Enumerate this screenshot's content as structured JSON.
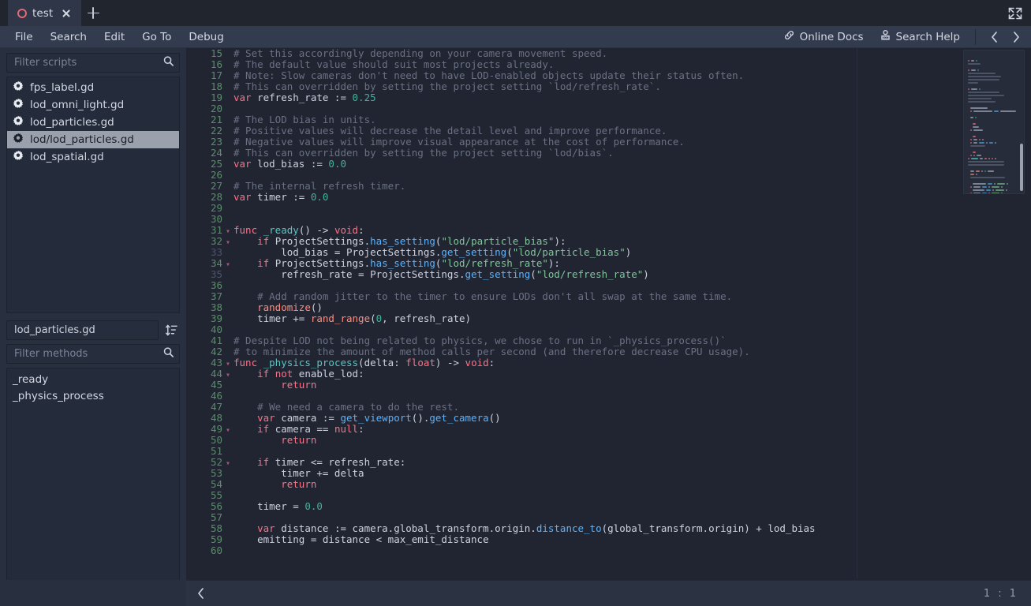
{
  "window": {
    "tab": {
      "name": "test",
      "close_label": "✕",
      "new_tab_label": "+"
    },
    "expand_icon": "fullscreen-icon"
  },
  "menu": {
    "items": [
      "File",
      "Search",
      "Edit",
      "Go To",
      "Debug"
    ],
    "online_docs": "Online Docs",
    "search_help": "Search Help",
    "prev_label": "‹",
    "next_label": "›"
  },
  "sidebar": {
    "filter_scripts_placeholder": "Filter scripts",
    "scripts": [
      {
        "label": "fps_label.gd",
        "selected": false
      },
      {
        "label": "lod_omni_light.gd",
        "selected": false
      },
      {
        "label": "lod_particles.gd",
        "selected": false
      },
      {
        "label": "lod/lod_particles.gd",
        "selected": true
      },
      {
        "label": "lod_spatial.gd",
        "selected": false
      }
    ],
    "current_script": "lod_particles.gd",
    "sort_icon": "sort-icon",
    "filter_methods_placeholder": "Filter methods",
    "methods": [
      "_ready",
      "_physics_process"
    ]
  },
  "status": {
    "back_label": "‹",
    "position": "1 : 1"
  },
  "editor": {
    "first_line": 15,
    "lines": [
      {
        "n": 15,
        "fold": "",
        "dim": false,
        "tokens": [
          {
            "t": "# Set this accordingly depending on your camera movement speed.",
            "c": "cm"
          }
        ]
      },
      {
        "n": 16,
        "fold": "",
        "dim": false,
        "tokens": [
          {
            "t": "# The default value should suit most projects already.",
            "c": "cm"
          }
        ]
      },
      {
        "n": 17,
        "fold": "",
        "dim": false,
        "tokens": [
          {
            "t": "# Note: Slow cameras don't need to have LOD-enabled objects update their status often.",
            "c": "cm"
          }
        ]
      },
      {
        "n": 18,
        "fold": "",
        "dim": false,
        "tokens": [
          {
            "t": "# This can overridden by setting the project setting `lod/refresh_rate`.",
            "c": "cm"
          }
        ]
      },
      {
        "n": 19,
        "fold": "",
        "dim": false,
        "tokens": [
          {
            "t": "var",
            "c": "kw"
          },
          {
            "t": " refresh_rate := ",
            "c": "pl"
          },
          {
            "t": "0.25",
            "c": "numlit"
          }
        ]
      },
      {
        "n": 20,
        "fold": "",
        "dim": false,
        "tokens": []
      },
      {
        "n": 21,
        "fold": "",
        "dim": false,
        "tokens": [
          {
            "t": "# The LOD bias in units.",
            "c": "cm"
          }
        ]
      },
      {
        "n": 22,
        "fold": "",
        "dim": false,
        "tokens": [
          {
            "t": "# Positive values will decrease the detail level and improve performance.",
            "c": "cm"
          }
        ]
      },
      {
        "n": 23,
        "fold": "",
        "dim": false,
        "tokens": [
          {
            "t": "# Negative values will improve visual appearance at the cost of performance.",
            "c": "cm"
          }
        ]
      },
      {
        "n": 24,
        "fold": "",
        "dim": false,
        "tokens": [
          {
            "t": "# This can overridden by setting the project setting `lod/bias`.",
            "c": "cm"
          }
        ]
      },
      {
        "n": 25,
        "fold": "",
        "dim": false,
        "tokens": [
          {
            "t": "var",
            "c": "kw"
          },
          {
            "t": " lod_bias := ",
            "c": "pl"
          },
          {
            "t": "0.0",
            "c": "numlit"
          }
        ]
      },
      {
        "n": 26,
        "fold": "",
        "dim": false,
        "tokens": []
      },
      {
        "n": 27,
        "fold": "",
        "dim": false,
        "tokens": [
          {
            "t": "# The internal refresh timer.",
            "c": "cm"
          }
        ]
      },
      {
        "n": 28,
        "fold": "",
        "dim": false,
        "tokens": [
          {
            "t": "var",
            "c": "kw"
          },
          {
            "t": " timer := ",
            "c": "pl"
          },
          {
            "t": "0.0",
            "c": "numlit"
          }
        ]
      },
      {
        "n": 29,
        "fold": "",
        "dim": false,
        "tokens": []
      },
      {
        "n": 30,
        "fold": "",
        "dim": false,
        "tokens": []
      },
      {
        "n": 31,
        "fold": "v",
        "dim": false,
        "tokens": [
          {
            "t": "func",
            "c": "kw"
          },
          {
            "t": " _ready",
            "c": "ty"
          },
          {
            "t": "() -> ",
            "c": "pl"
          },
          {
            "t": "void",
            "c": "kw"
          },
          {
            "t": ":",
            "c": "pl"
          }
        ]
      },
      {
        "n": 32,
        "fold": "v",
        "dim": false,
        "tokens": [
          {
            "t": "    ",
            "c": "pl"
          },
          {
            "t": "if",
            "c": "kw"
          },
          {
            "t": " ProjectSettings.",
            "c": "pl"
          },
          {
            "t": "has_setting",
            "c": "fn"
          },
          {
            "t": "(",
            "c": "pl"
          },
          {
            "t": "\"lod/particle_bias\"",
            "c": "str"
          },
          {
            "t": "):",
            "c": "pl"
          }
        ]
      },
      {
        "n": 33,
        "fold": "",
        "dim": true,
        "tokens": [
          {
            "t": "        lod_bias = ProjectSettings.",
            "c": "pl"
          },
          {
            "t": "get_setting",
            "c": "fn"
          },
          {
            "t": "(",
            "c": "pl"
          },
          {
            "t": "\"lod/particle_bias\"",
            "c": "str"
          },
          {
            "t": ")",
            "c": "pl"
          }
        ]
      },
      {
        "n": 34,
        "fold": "v",
        "dim": false,
        "tokens": [
          {
            "t": "    ",
            "c": "pl"
          },
          {
            "t": "if",
            "c": "kw"
          },
          {
            "t": " ProjectSettings.",
            "c": "pl"
          },
          {
            "t": "has_setting",
            "c": "fn"
          },
          {
            "t": "(",
            "c": "pl"
          },
          {
            "t": "\"lod/refresh_rate\"",
            "c": "str"
          },
          {
            "t": "):",
            "c": "pl"
          }
        ]
      },
      {
        "n": 35,
        "fold": "",
        "dim": true,
        "tokens": [
          {
            "t": "        refresh_rate = ProjectSettings.",
            "c": "pl"
          },
          {
            "t": "get_setting",
            "c": "fn"
          },
          {
            "t": "(",
            "c": "pl"
          },
          {
            "t": "\"lod/refresh_rate\"",
            "c": "str"
          },
          {
            "t": ")",
            "c": "pl"
          }
        ]
      },
      {
        "n": 36,
        "fold": "",
        "dim": false,
        "tokens": []
      },
      {
        "n": 37,
        "fold": "",
        "dim": false,
        "tokens": [
          {
            "t": "    # Add random jitter to the timer to ensure LODs don't all swap at the same time.",
            "c": "cm"
          }
        ]
      },
      {
        "n": 38,
        "fold": "",
        "dim": false,
        "tokens": [
          {
            "t": "    ",
            "c": "pl"
          },
          {
            "t": "randomize",
            "c": "bi"
          },
          {
            "t": "()",
            "c": "pl"
          }
        ]
      },
      {
        "n": 39,
        "fold": "",
        "dim": false,
        "tokens": [
          {
            "t": "    timer += ",
            "c": "pl"
          },
          {
            "t": "rand_range",
            "c": "bi"
          },
          {
            "t": "(",
            "c": "pl"
          },
          {
            "t": "0",
            "c": "numlit"
          },
          {
            "t": ", refresh_rate)",
            "c": "pl"
          }
        ]
      },
      {
        "n": 40,
        "fold": "",
        "dim": false,
        "tokens": []
      },
      {
        "n": 41,
        "fold": "",
        "dim": false,
        "tokens": [
          {
            "t": "# Despite LOD not being related to physics, we chose to run in `_physics_process()`",
            "c": "cm"
          }
        ]
      },
      {
        "n": 42,
        "fold": "",
        "dim": false,
        "tokens": [
          {
            "t": "# to minimize the amount of method calls per second (and therefore decrease CPU usage).",
            "c": "cm"
          }
        ]
      },
      {
        "n": 43,
        "fold": "v",
        "dim": false,
        "tokens": [
          {
            "t": "func",
            "c": "kw"
          },
          {
            "t": " _physics_process",
            "c": "ty"
          },
          {
            "t": "(delta: ",
            "c": "pl"
          },
          {
            "t": "float",
            "c": "kw"
          },
          {
            "t": ") -> ",
            "c": "pl"
          },
          {
            "t": "void",
            "c": "kw"
          },
          {
            "t": ":",
            "c": "pl"
          }
        ]
      },
      {
        "n": 44,
        "fold": "v",
        "dim": false,
        "tokens": [
          {
            "t": "    ",
            "c": "pl"
          },
          {
            "t": "if",
            "c": "kw"
          },
          {
            "t": " ",
            "c": "pl"
          },
          {
            "t": "not",
            "c": "kw"
          },
          {
            "t": " enable_lod:",
            "c": "pl"
          }
        ]
      },
      {
        "n": 45,
        "fold": "",
        "dim": false,
        "tokens": [
          {
            "t": "        ",
            "c": "pl"
          },
          {
            "t": "return",
            "c": "kw"
          }
        ]
      },
      {
        "n": 46,
        "fold": "",
        "dim": false,
        "tokens": []
      },
      {
        "n": 47,
        "fold": "",
        "dim": false,
        "tokens": [
          {
            "t": "    # We need a camera to do the rest.",
            "c": "cm"
          }
        ]
      },
      {
        "n": 48,
        "fold": "",
        "dim": false,
        "tokens": [
          {
            "t": "    ",
            "c": "pl"
          },
          {
            "t": "var",
            "c": "kw"
          },
          {
            "t": " camera := ",
            "c": "pl"
          },
          {
            "t": "get_viewport",
            "c": "fn"
          },
          {
            "t": "().",
            "c": "pl"
          },
          {
            "t": "get_camera",
            "c": "fn"
          },
          {
            "t": "()",
            "c": "pl"
          }
        ]
      },
      {
        "n": 49,
        "fold": "v",
        "dim": false,
        "tokens": [
          {
            "t": "    ",
            "c": "pl"
          },
          {
            "t": "if",
            "c": "kw"
          },
          {
            "t": " camera == ",
            "c": "pl"
          },
          {
            "t": "null",
            "c": "kw"
          },
          {
            "t": ":",
            "c": "pl"
          }
        ]
      },
      {
        "n": 50,
        "fold": "",
        "dim": false,
        "tokens": [
          {
            "t": "        ",
            "c": "pl"
          },
          {
            "t": "return",
            "c": "kw"
          }
        ]
      },
      {
        "n": 51,
        "fold": "",
        "dim": false,
        "tokens": []
      },
      {
        "n": 52,
        "fold": "v",
        "dim": false,
        "tokens": [
          {
            "t": "    ",
            "c": "pl"
          },
          {
            "t": "if",
            "c": "kw"
          },
          {
            "t": " timer <= refresh_rate:",
            "c": "pl"
          }
        ]
      },
      {
        "n": 53,
        "fold": "",
        "dim": false,
        "tokens": [
          {
            "t": "        timer += delta",
            "c": "pl"
          }
        ]
      },
      {
        "n": 54,
        "fold": "",
        "dim": false,
        "tokens": [
          {
            "t": "        ",
            "c": "pl"
          },
          {
            "t": "return",
            "c": "kw"
          }
        ]
      },
      {
        "n": 55,
        "fold": "",
        "dim": false,
        "tokens": []
      },
      {
        "n": 56,
        "fold": "",
        "dim": false,
        "tokens": [
          {
            "t": "    timer = ",
            "c": "pl"
          },
          {
            "t": "0.0",
            "c": "numlit"
          }
        ]
      },
      {
        "n": 57,
        "fold": "",
        "dim": false,
        "tokens": []
      },
      {
        "n": 58,
        "fold": "",
        "dim": false,
        "tokens": [
          {
            "t": "    ",
            "c": "pl"
          },
          {
            "t": "var",
            "c": "kw"
          },
          {
            "t": " distance := camera.global_transform.origin.",
            "c": "pl"
          },
          {
            "t": "distance_to",
            "c": "fn"
          },
          {
            "t": "(global_transform.origin) + lod_bias",
            "c": "pl"
          }
        ]
      },
      {
        "n": 59,
        "fold": "",
        "dim": false,
        "tokens": [
          {
            "t": "    emitting = distance < max_emit_distance",
            "c": "pl"
          }
        ]
      },
      {
        "n": 60,
        "fold": "",
        "dim": false,
        "tokens": []
      }
    ]
  },
  "colors": {
    "editor_bg": "#212532",
    "panel_bg": "#282f3e",
    "list_bg": "#242b3b",
    "menubar_bg": "#333b4f",
    "tabbar_bg": "#21252e",
    "accent_red": "#e06b74",
    "keyword": "#ff7085",
    "function": "#57b3ff",
    "string": "#7ec699",
    "comment": "#6a7184",
    "number": "#3fb39b",
    "selection": "#9aa1ad"
  }
}
